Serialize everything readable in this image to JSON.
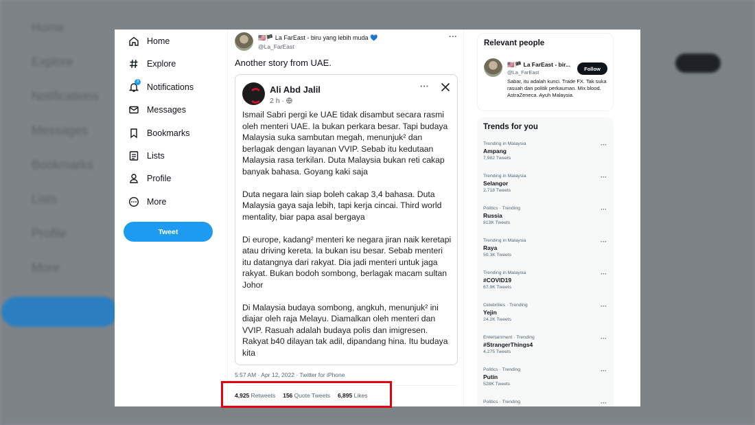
{
  "nav": {
    "items": [
      {
        "label": "Home",
        "icon": "home-icon"
      },
      {
        "label": "Explore",
        "icon": "hashtag-icon"
      },
      {
        "label": "Notifications",
        "icon": "bell-icon",
        "badge": "3"
      },
      {
        "label": "Messages",
        "icon": "envelope-icon"
      },
      {
        "label": "Bookmarks",
        "icon": "bookmark-icon"
      },
      {
        "label": "Lists",
        "icon": "list-icon"
      },
      {
        "label": "Profile",
        "icon": "person-icon"
      },
      {
        "label": "More",
        "icon": "more-circle-icon"
      }
    ],
    "tweet_button": "Tweet"
  },
  "tweet": {
    "author_name": "🇺🇸🏴 La FarEast - biru yang lebih muda 💙",
    "author_handle": "@La_FarEast",
    "text": "Another story from UAE.",
    "timestamp": "5:57 AM · Apr 12, 2022 · Twitter for iPhone",
    "stats": {
      "retweets_count": "4,925",
      "retweets_label": "Retweets",
      "quotes_count": "156",
      "quotes_label": "Quote Tweets",
      "likes_count": "6,895",
      "likes_label": "Likes"
    }
  },
  "embedded_post": {
    "author": "Ali Abd Jalil",
    "meta": "2 h · ",
    "paragraphs": [
      "Ismail Sabri pergi ke UAE tidak disambut secara rasmi oleh menteri UAE. Ia bukan perkara besar. Tapi budaya Malaysia suka sambutan megah, menunjuk² dan berlagak dengan layanan VVIP. Sebab itu kedutaan Malaysia rasa terkilan. Duta Malaysia bukan reti cakap banyak bahasa. Goyang kaki saja",
      "Duta negara lain siap boleh cakap 3,4 bahasa. Duta Malaysia gaya saja lebih, tapi kerja cincai. Third world mentality, biar papa asal bergaya",
      "Di europe, kadang² menteri ke negara jiran naik keretapi atau driving kereta. Ia bukan isu besar. Sebab menteri itu datangnya dari rakyat. Dia jadi menteri untuk jaga rakyat. Bukan bodoh sombong, berlagak macam sultan Johor",
      "Di Malaysia budaya sombong, angkuh, menunjuk² ini diajar oleh raja Melayu. Diamalkan oleh menteri dan VVIP. Rasuah adalah budaya polis dan imigresen. Rakyat b40 dilayan tak adil, dipandang hina. Itu budaya kita"
    ]
  },
  "relevant_people": {
    "title": "Relevant people",
    "name": "🇺🇸🏴 La FarEast - bir...",
    "handle": "@La_FarEast",
    "follow_label": "Follow",
    "bio": "Sabar, itu adalah kunci. Trade FX. Tak suka rasuah dan politik perkauman. Mix blood. AstraZeneca. Ayuh Malaysia."
  },
  "trends": {
    "title": "Trends for you",
    "items": [
      {
        "meta": "Trending in Malaysia",
        "name": "Ampang",
        "count": "7,982 Tweets"
      },
      {
        "meta": "Trending in Malaysia",
        "name": "Selangor",
        "count": "2,718 Tweets"
      },
      {
        "meta": "Politics · Trending",
        "name": "Russia",
        "count": "813K Tweets"
      },
      {
        "meta": "Trending in Malaysia",
        "name": "Raya",
        "count": "50.3K Tweets"
      },
      {
        "meta": "Trending in Malaysia",
        "name": "#COVID19",
        "count": "67.9K Tweets"
      },
      {
        "meta": "Celebrities · Trending",
        "name": "Yejin",
        "count": "24.2K Tweets"
      },
      {
        "meta": "Entertainment · Trending",
        "name": "#StrangerThings4",
        "count": "4,275 Tweets"
      },
      {
        "meta": "Politics · Trending",
        "name": "Putin",
        "count": "528K Tweets"
      },
      {
        "meta": "Politics · Trending",
        "name": "",
        "count": ""
      }
    ]
  },
  "background": {
    "labels": [
      "Home",
      "Explore",
      "Notifications",
      "Messages",
      "Bookmarks",
      "Lists",
      "Profile",
      "More"
    ]
  },
  "colors": {
    "accent": "#1d9bf0",
    "highlight": "#e3000f"
  }
}
